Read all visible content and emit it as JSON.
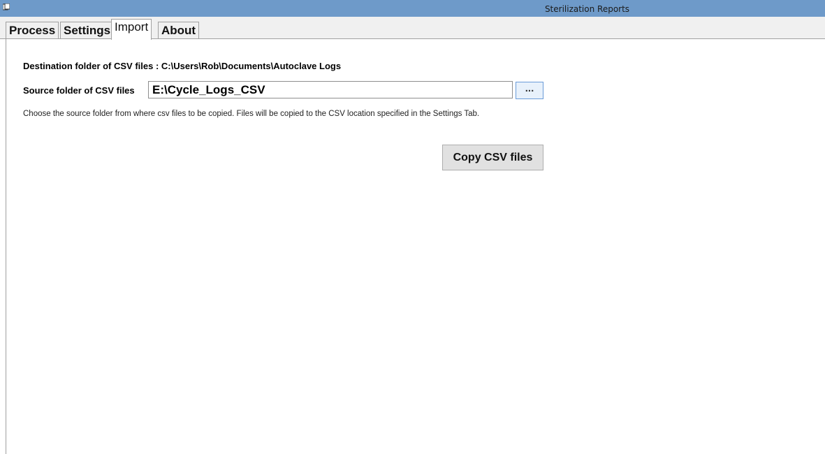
{
  "window": {
    "title": "Sterilization Reports",
    "icon": "app-icon",
    "titlebar_color": "#6e9ac9"
  },
  "tabs": [
    {
      "label": "Process",
      "active": false
    },
    {
      "label": "Settings",
      "active": false
    },
    {
      "label": "Import",
      "active": true
    },
    {
      "label": "About",
      "active": false
    }
  ],
  "import": {
    "destination_label": "Destination folder of CSV files : C:\\Users\\Rob\\Documents\\Autoclave Logs",
    "source_label": "Source folder of CSV files",
    "source_value": "E:\\Cycle_Logs_CSV",
    "browse_label": "...",
    "help_text": "Choose the source folder from where csv files to be copied.  Files will be copied to the CSV location specified in the Settings Tab.",
    "copy_button_label": "Copy CSV files"
  }
}
